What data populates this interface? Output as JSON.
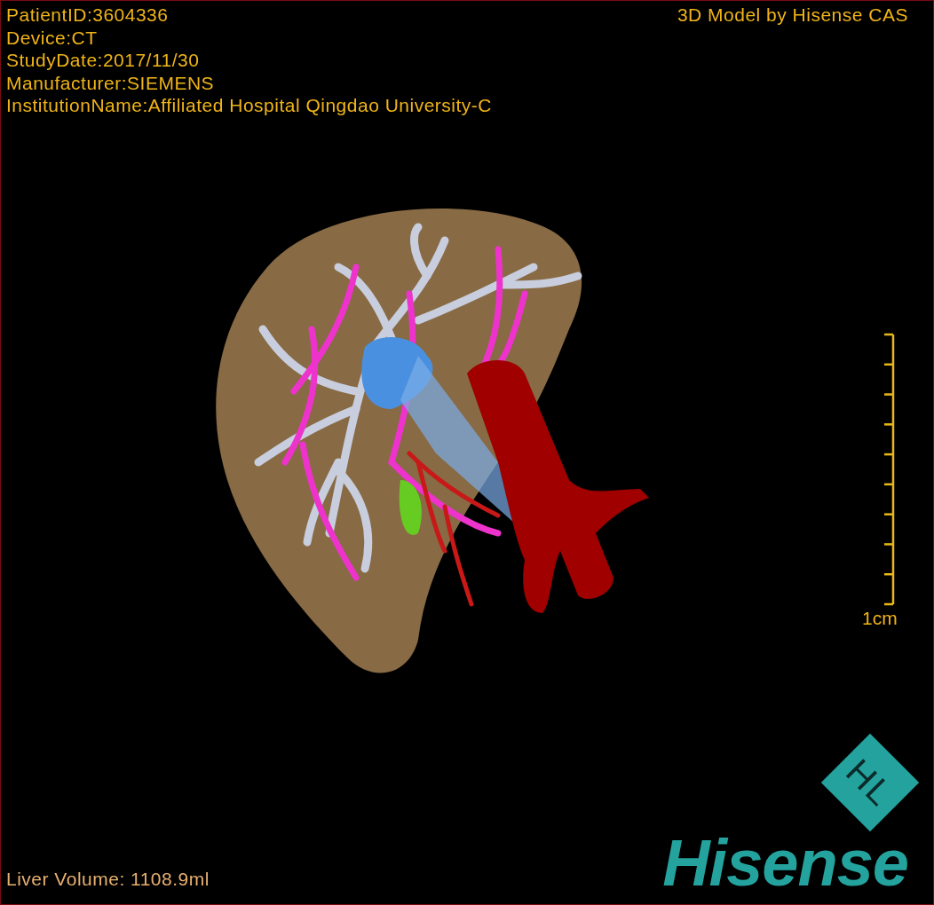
{
  "info_lines": [
    "PatientID:3604336",
    "Device:CT",
    "StudyDate:2017/11/30",
    "Manufacturer:SIEMENS",
    "InstitutionName:Affiliated Hospital Qingdao University-C"
  ],
  "title": "3D Model by Hisense CAS",
  "scale_bar": {
    "label": "1cm"
  },
  "liver_volume": "Liver Volume: 1108.9ml",
  "logo": {
    "emblem": "HL",
    "wordmark": "Hisense"
  }
}
